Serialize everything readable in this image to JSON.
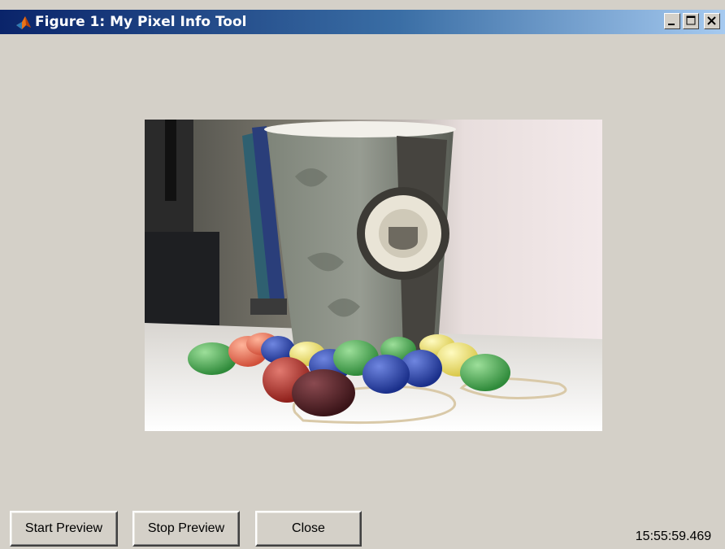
{
  "window": {
    "title": "Figure 1: My Pixel Info Tool"
  },
  "buttons": {
    "start_preview": "Start Preview",
    "stop_preview": "Stop Preview",
    "close": "Close"
  },
  "status": {
    "timestamp": "15:55:59.469"
  },
  "image": {
    "subject": "paper coffee cup with colored candies on table"
  },
  "colors": {
    "title_active": "#0a246a",
    "face": "#d4d0c8"
  }
}
